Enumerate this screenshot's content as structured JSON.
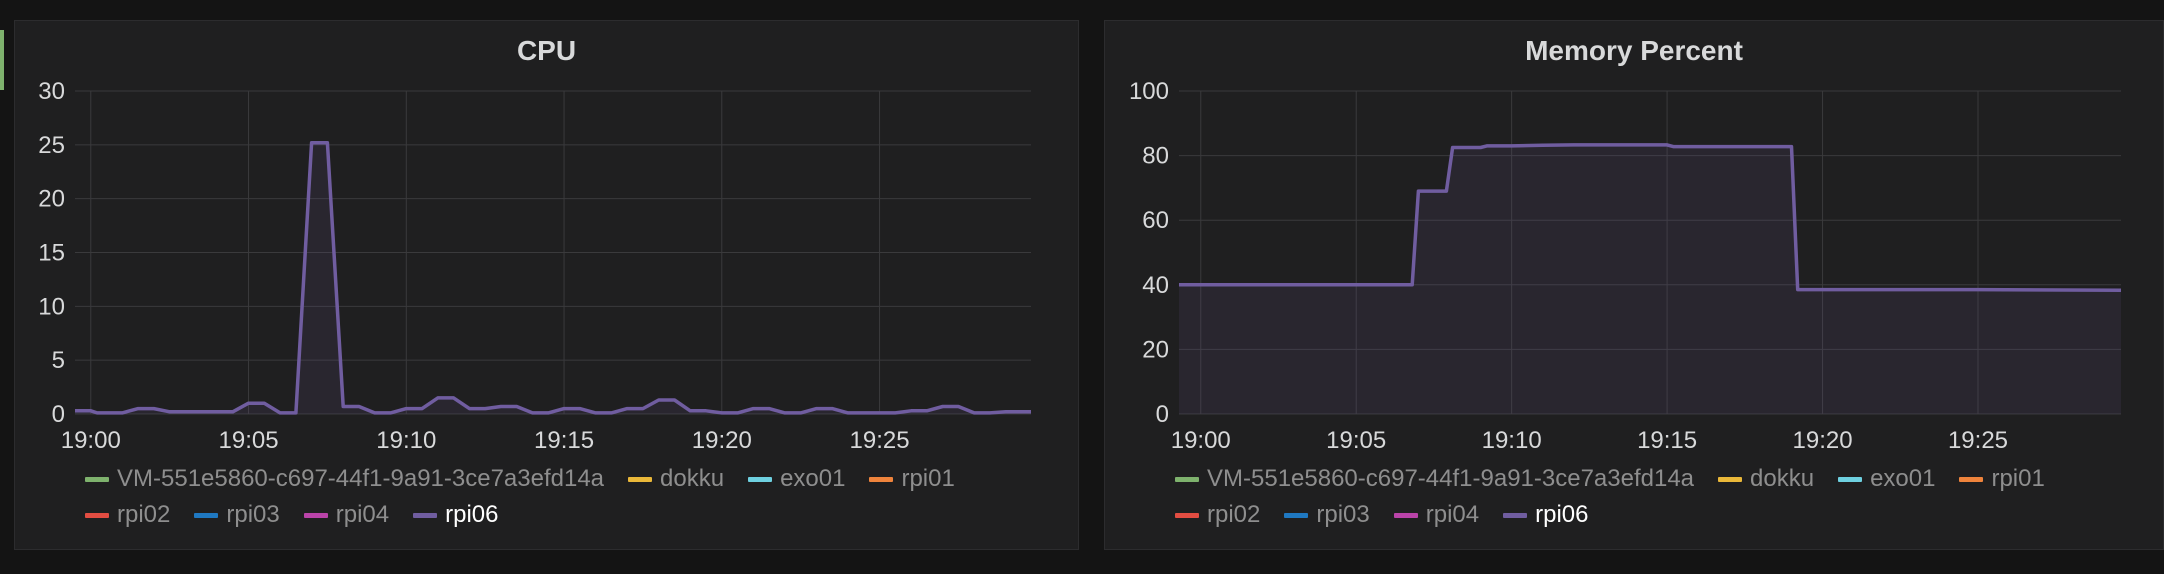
{
  "chart_data": [
    {
      "type": "line",
      "title": "CPU",
      "x_ticks": [
        "19:00",
        "19:05",
        "19:10",
        "19:15",
        "19:20",
        "19:25"
      ],
      "y_ticks": [
        0,
        5,
        10,
        15,
        20,
        25,
        30
      ],
      "ylim": [
        0,
        30
      ],
      "xlim_minutes": [
        -0.5,
        29.8
      ],
      "grid": true,
      "legend_position": "bottom",
      "series": [
        {
          "name": "VM-551e5860-c697-44f1-9a91-3ce7a3efd14a",
          "color": "#7eb26d",
          "values": []
        },
        {
          "name": "dokku",
          "color": "#eab839",
          "values": []
        },
        {
          "name": "exo01",
          "color": "#6ed0e0",
          "values": []
        },
        {
          "name": "rpi01",
          "color": "#ef843c",
          "values": []
        },
        {
          "name": "rpi02",
          "color": "#e24d42",
          "values": []
        },
        {
          "name": "rpi03",
          "color": "#1f78c1",
          "values": []
        },
        {
          "name": "rpi04",
          "color": "#ba43a9",
          "values": []
        },
        {
          "name": "rpi06",
          "color": "#705da0",
          "active": true,
          "x": [
            -0.5,
            0,
            0.2,
            1,
            1.5,
            2,
            2.5,
            3,
            3.5,
            4,
            4.5,
            5,
            5.5,
            6,
            6.5,
            7,
            7.5,
            8,
            8.5,
            9,
            9.5,
            10,
            10.5,
            11,
            11.5,
            12,
            12.5,
            13,
            13.5,
            14,
            14.5,
            15,
            15.5,
            16,
            16.5,
            17,
            17.5,
            18,
            18.5,
            19,
            19.5,
            20,
            20.5,
            21,
            21.5,
            22,
            22.5,
            23,
            23.5,
            24,
            24.5,
            25,
            25.5,
            26,
            26.5,
            27,
            27.5,
            28,
            28.5,
            29,
            29.5,
            29.8
          ],
          "values": [
            0.3,
            0.3,
            0.1,
            0.1,
            0.5,
            0.5,
            0.2,
            0.2,
            0.2,
            0.2,
            0.2,
            1,
            1,
            0.1,
            0.1,
            25.2,
            25.2,
            0.7,
            0.7,
            0.1,
            0.1,
            0.5,
            0.5,
            1.5,
            1.5,
            0.5,
            0.5,
            0.7,
            0.7,
            0.1,
            0.1,
            0.5,
            0.5,
            0.1,
            0.1,
            0.5,
            0.5,
            1.3,
            1.3,
            0.3,
            0.3,
            0.1,
            0.1,
            0.5,
            0.5,
            0.1,
            0.1,
            0.5,
            0.5,
            0.1,
            0.1,
            0.1,
            0.1,
            0.3,
            0.3,
            0.7,
            0.7,
            0.1,
            0.1,
            0.2,
            0.2,
            0.2
          ]
        }
      ]
    },
    {
      "type": "area",
      "title": "Memory Percent",
      "x_ticks": [
        "19:00",
        "19:05",
        "19:10",
        "19:15",
        "19:20",
        "19:25"
      ],
      "y_ticks": [
        0,
        20,
        40,
        60,
        80,
        100
      ],
      "ylim": [
        0,
        100
      ],
      "xlim_minutes": [
        -0.7,
        29.6
      ],
      "grid": true,
      "legend_position": "bottom",
      "series": [
        {
          "name": "VM-551e5860-c697-44f1-9a91-3ce7a3efd14a",
          "color": "#7eb26d",
          "values": []
        },
        {
          "name": "dokku",
          "color": "#eab839",
          "values": []
        },
        {
          "name": "exo01",
          "color": "#6ed0e0",
          "values": []
        },
        {
          "name": "rpi01",
          "color": "#ef843c",
          "values": []
        },
        {
          "name": "rpi02",
          "color": "#e24d42",
          "values": []
        },
        {
          "name": "rpi03",
          "color": "#1f78c1",
          "values": []
        },
        {
          "name": "rpi04",
          "color": "#ba43a9",
          "values": []
        },
        {
          "name": "rpi06",
          "color": "#705da0",
          "active": true,
          "x": [
            -0.7,
            6.8,
            7,
            7.9,
            8.1,
            9,
            9.2,
            10,
            11,
            12,
            13,
            14,
            15,
            15.2,
            16,
            17,
            18,
            19,
            19.2,
            20,
            25,
            29.6
          ],
          "values": [
            40,
            40,
            69,
            69,
            82.5,
            82.5,
            83,
            83,
            83.2,
            83.3,
            83.3,
            83.3,
            83.3,
            82.8,
            82.8,
            82.8,
            82.8,
            82.8,
            38.5,
            38.5,
            38.5,
            38.3
          ]
        }
      ]
    }
  ]
}
